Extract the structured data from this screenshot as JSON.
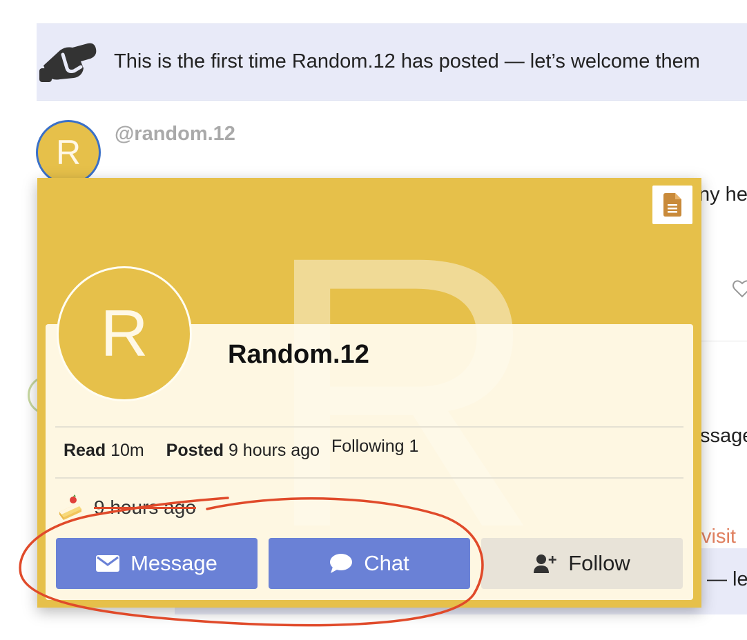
{
  "banner": {
    "icon": "handshake-icon",
    "text": "This is the first time Random.12 has posted — let’s welcome them"
  },
  "post": {
    "avatar_letter": "R",
    "username": "@random.12",
    "text_fragment_1": "ny he",
    "text_fragment_2": "ssage",
    "text_fragment_3": "visit",
    "text_fragment_4": "— le"
  },
  "user_card": {
    "background_letter": "R",
    "avatar_letter": "R",
    "name": "Random.12",
    "stats": {
      "read_label": "Read",
      "read_value": "10m",
      "posted_label": "Posted",
      "posted_value": "9 hours ago",
      "following": "Following 1"
    },
    "cake_day": {
      "icon": "cake-icon",
      "text": "9 hours ago"
    },
    "buttons": {
      "message": "Message",
      "chat": "Chat",
      "follow": "Follow"
    }
  },
  "colors": {
    "card_background": "#e6c04a",
    "button_blue": "#6a81d6",
    "button_grey": "#e8e3d8",
    "annotation_red": "#e04a2a",
    "banner_background": "#e8eaf8"
  }
}
